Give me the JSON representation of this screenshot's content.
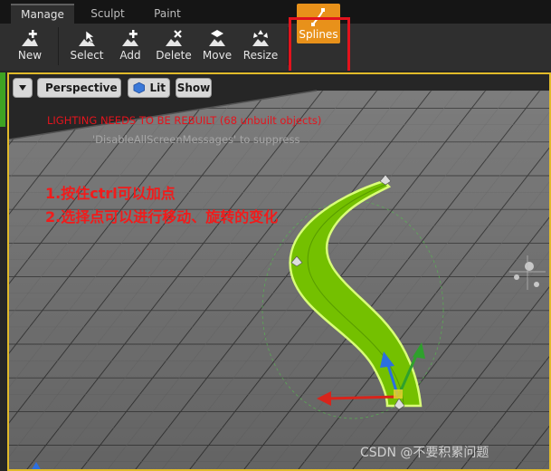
{
  "tabs": [
    "Manage",
    "Sculpt",
    "Paint"
  ],
  "tools": [
    {
      "label": "New",
      "icon": "new-icon"
    },
    {
      "label": "Select",
      "icon": "select-icon"
    },
    {
      "label": "Add",
      "icon": "add-icon"
    },
    {
      "label": "Delete",
      "icon": "delete-icon"
    },
    {
      "label": "Move",
      "icon": "move-icon"
    },
    {
      "label": "Resize",
      "icon": "resize-icon"
    },
    {
      "label": "Splines",
      "icon": "splines-icon",
      "active": true
    }
  ],
  "viewport": {
    "menu_icon": "chevron-down-icon",
    "perspective": "Perspective",
    "lit": "Lit",
    "show": "Show"
  },
  "messages": {
    "warning": "LIGHTING NEEDS TO BE REBUILT (68 unbuilt objects)",
    "suppress": "'DisableAllScreenMessages' to suppress"
  },
  "annotations": [
    "1.按住ctrl可以加点",
    "2.选择点可以进行移动、旋转的变化"
  ],
  "watermark": "CSDN @不要积累问题",
  "colors": {
    "accent": "#e8911a",
    "highlight": "#e2131d",
    "spline": "#7cc400",
    "viewport_border": "#e1ba2a"
  }
}
